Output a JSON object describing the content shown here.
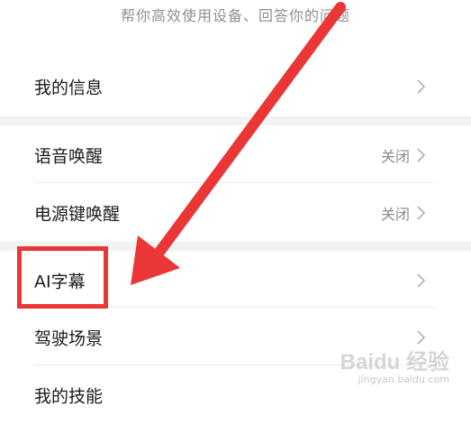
{
  "header": {
    "subtitle": "帮你高效使用设备、回答你的问题"
  },
  "settings": {
    "my_info": {
      "label": "我的信息"
    },
    "voice_wakeup": {
      "label": "语音唤醒",
      "value": "关闭"
    },
    "power_key_wakeup": {
      "label": "电源键唤醒",
      "value": "关闭"
    },
    "ai_subtitles": {
      "label": "AI字幕"
    },
    "driving_scene": {
      "label": "驾驶场景"
    },
    "my_skills": {
      "label": "我的技能"
    }
  },
  "annotation": {
    "color": "#ea3636"
  },
  "watermark": {
    "main": "Baidu 经验",
    "sub": "jingyan.baidu.com"
  },
  "icons": {
    "chevron": "chevron-right-icon"
  }
}
